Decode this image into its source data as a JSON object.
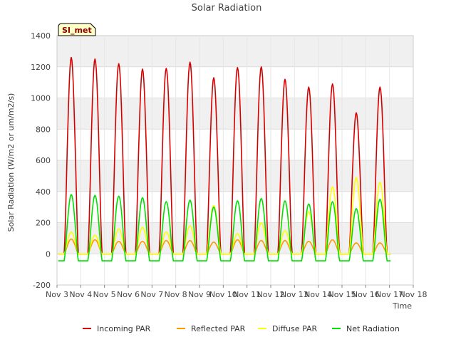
{
  "chart_data": {
    "type": "line",
    "title": "Solar Radiation",
    "xlabel": "Time",
    "ylabel": "Solar Radiation (W/m2 or um/m2/s)",
    "site_label": "SI_met",
    "ylim": [
      -200,
      1400
    ],
    "yticks": [
      -200,
      0,
      200,
      400,
      600,
      800,
      1000,
      1200,
      1400
    ],
    "xlim": [
      3,
      18
    ],
    "xticks": [
      3,
      4,
      5,
      6,
      7,
      8,
      9,
      10,
      11,
      12,
      13,
      14,
      15,
      16,
      17,
      18
    ],
    "xtick_labels": [
      "Nov 3",
      "Nov 4",
      "Nov 5",
      "Nov 6",
      "Nov 7",
      "Nov 8",
      "Nov 9",
      "Nov 10",
      "Nov 11",
      "Nov 12",
      "Nov 13",
      "Nov 14",
      "Nov 15",
      "Nov 16",
      "Nov 17",
      "Nov 18"
    ],
    "grid": true,
    "legend_position": "bottom",
    "days": [
      3.6,
      4.6,
      5.6,
      6.6,
      7.6,
      8.6,
      9.6,
      10.6,
      11.6,
      12.6,
      13.6,
      14.6,
      15.6,
      16.6
    ],
    "series": [
      {
        "name": "Incoming PAR",
        "color": "#d40000",
        "peaks": [
          1260,
          1250,
          1220,
          1185,
          1190,
          1230,
          1130,
          1195,
          1200,
          1120,
          1070,
          1090,
          905,
          1070
        ],
        "night": 0
      },
      {
        "name": "Reflected PAR",
        "color": "#ff9900",
        "peaks": [
          95,
          90,
          80,
          80,
          85,
          85,
          75,
          90,
          85,
          85,
          80,
          90,
          70,
          70
        ],
        "night": 0
      },
      {
        "name": "Diffuse PAR",
        "color": "#ffff00",
        "peaks": [
          140,
          120,
          160,
          170,
          140,
          180,
          310,
          130,
          200,
          150,
          270,
          430,
          490,
          460
        ],
        "night": 0
      },
      {
        "name": "Net Radiation",
        "color": "#00e000",
        "peaks": [
          380,
          375,
          370,
          360,
          335,
          345,
          300,
          340,
          355,
          340,
          320,
          335,
          290,
          350
        ],
        "night": -45
      }
    ]
  }
}
